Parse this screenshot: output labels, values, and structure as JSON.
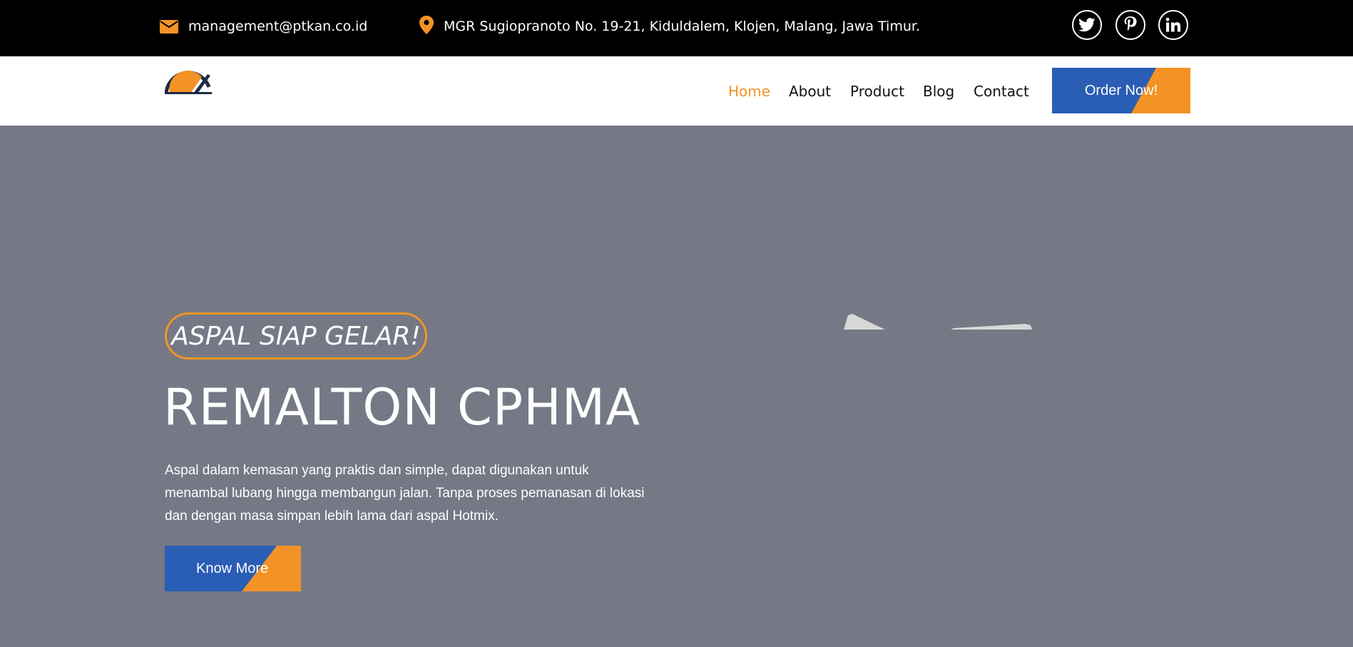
{
  "topbar": {
    "email": "management@ptkan.co.id",
    "address": "MGR Sugiopranoto No. 19-21, Kiduldalem, Klojen, Malang, Jawa Timur.",
    "social": [
      "twitter-icon",
      "pinterest-icon",
      "linkedin-icon"
    ]
  },
  "nav": {
    "items": [
      "Home",
      "About",
      "Product",
      "Blog",
      "Contact"
    ],
    "active": "Home",
    "order_button": "Order Now!"
  },
  "hero": {
    "tagline": "ASPAL SIAP GELAR!",
    "title": "REMALTON CPHMA",
    "description": "Aspal dalam kemasan yang praktis dan simple, dapat digunakan untuk menambal lubang hingga membangun jalan. Tanpa proses pemanasan di lokasi dan dengan masa simpan lebih lama dari aspal Hotmix.",
    "button": "Know More"
  },
  "colors": {
    "accent": "#f39325",
    "primary": "#2a5db4",
    "topbar_bg": "#000000",
    "hero_bg": "#757885"
  }
}
